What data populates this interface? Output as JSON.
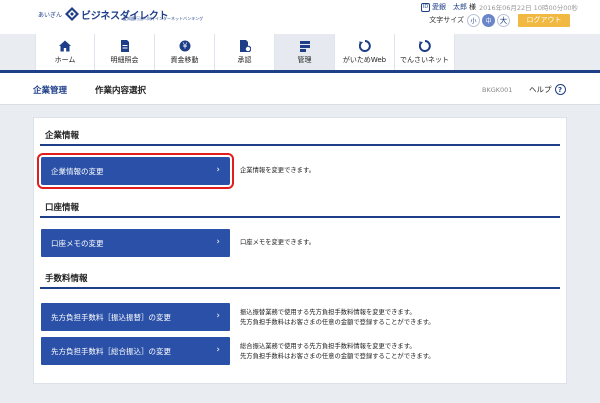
{
  "header": {
    "logo_small": "あいぎん",
    "logo_main": "ビジネスダイレクト",
    "logo_sub": "愛知銀行法人向けインターネットバンキング",
    "user_icon": "ID",
    "user_name": "愛銀　太郎",
    "user_honorific": "様",
    "login_time": "2016年06月22日 10時00分00秒",
    "font_size_label": "文字サイズ",
    "font_small": "小",
    "font_medium": "中",
    "font_large": "大",
    "logout_label": "ログアウト"
  },
  "nav": {
    "items": [
      {
        "label": "ホーム",
        "icon": "home-icon"
      },
      {
        "label": "明細照会",
        "icon": "document-icon"
      },
      {
        "label": "資金移動",
        "icon": "yen-transfer-icon"
      },
      {
        "label": "承認",
        "icon": "approve-icon"
      },
      {
        "label": "管理",
        "icon": "manage-icon"
      },
      {
        "label": "がいためWeb",
        "icon": "web-icon"
      },
      {
        "label": "でんさいネット",
        "icon": "densai-icon"
      }
    ],
    "active_index": 4
  },
  "titlebar": {
    "breadcrumb_parent": "企業管理",
    "page_title": "作業内容選択",
    "screen_id": "BKGK001",
    "help_label": "ヘルプ",
    "help_icon": "?"
  },
  "sections": [
    {
      "title": "企業情報",
      "buttons": [
        {
          "label": "企業情報の変更",
          "chevron": "›",
          "highlighted": true,
          "desc": [
            "企業情報を変更できます。"
          ]
        }
      ]
    },
    {
      "title": "口座情報",
      "buttons": [
        {
          "label": "口座メモの変更",
          "chevron": "›",
          "highlighted": false,
          "desc": [
            "口座メモを変更できます。"
          ]
        }
      ]
    },
    {
      "title": "手数料情報",
      "buttons": [
        {
          "label": "先方負担手数料［振込振替］の変更",
          "chevron": "›",
          "highlighted": false,
          "desc": [
            "振込振替業務で使用する先方負担手数料情報を変更できます。",
            "先方負担手数料はお客さまの任意の金額で登録することができます。"
          ]
        },
        {
          "label": "先方負担手数料［総合振込］の変更",
          "chevron": "›",
          "highlighted": false,
          "desc": [
            "総合振込業務で使用する先方負担手数料情報を変更できます。",
            "先方負担手数料はお客さまの任意の金額で登録することができます。"
          ]
        }
      ]
    }
  ],
  "colors": {
    "brand": "#1e3e88",
    "button": "#2a50a8",
    "logout": "#f1b941",
    "highlight": "#e31d1d",
    "background": "#e9ecf1"
  }
}
